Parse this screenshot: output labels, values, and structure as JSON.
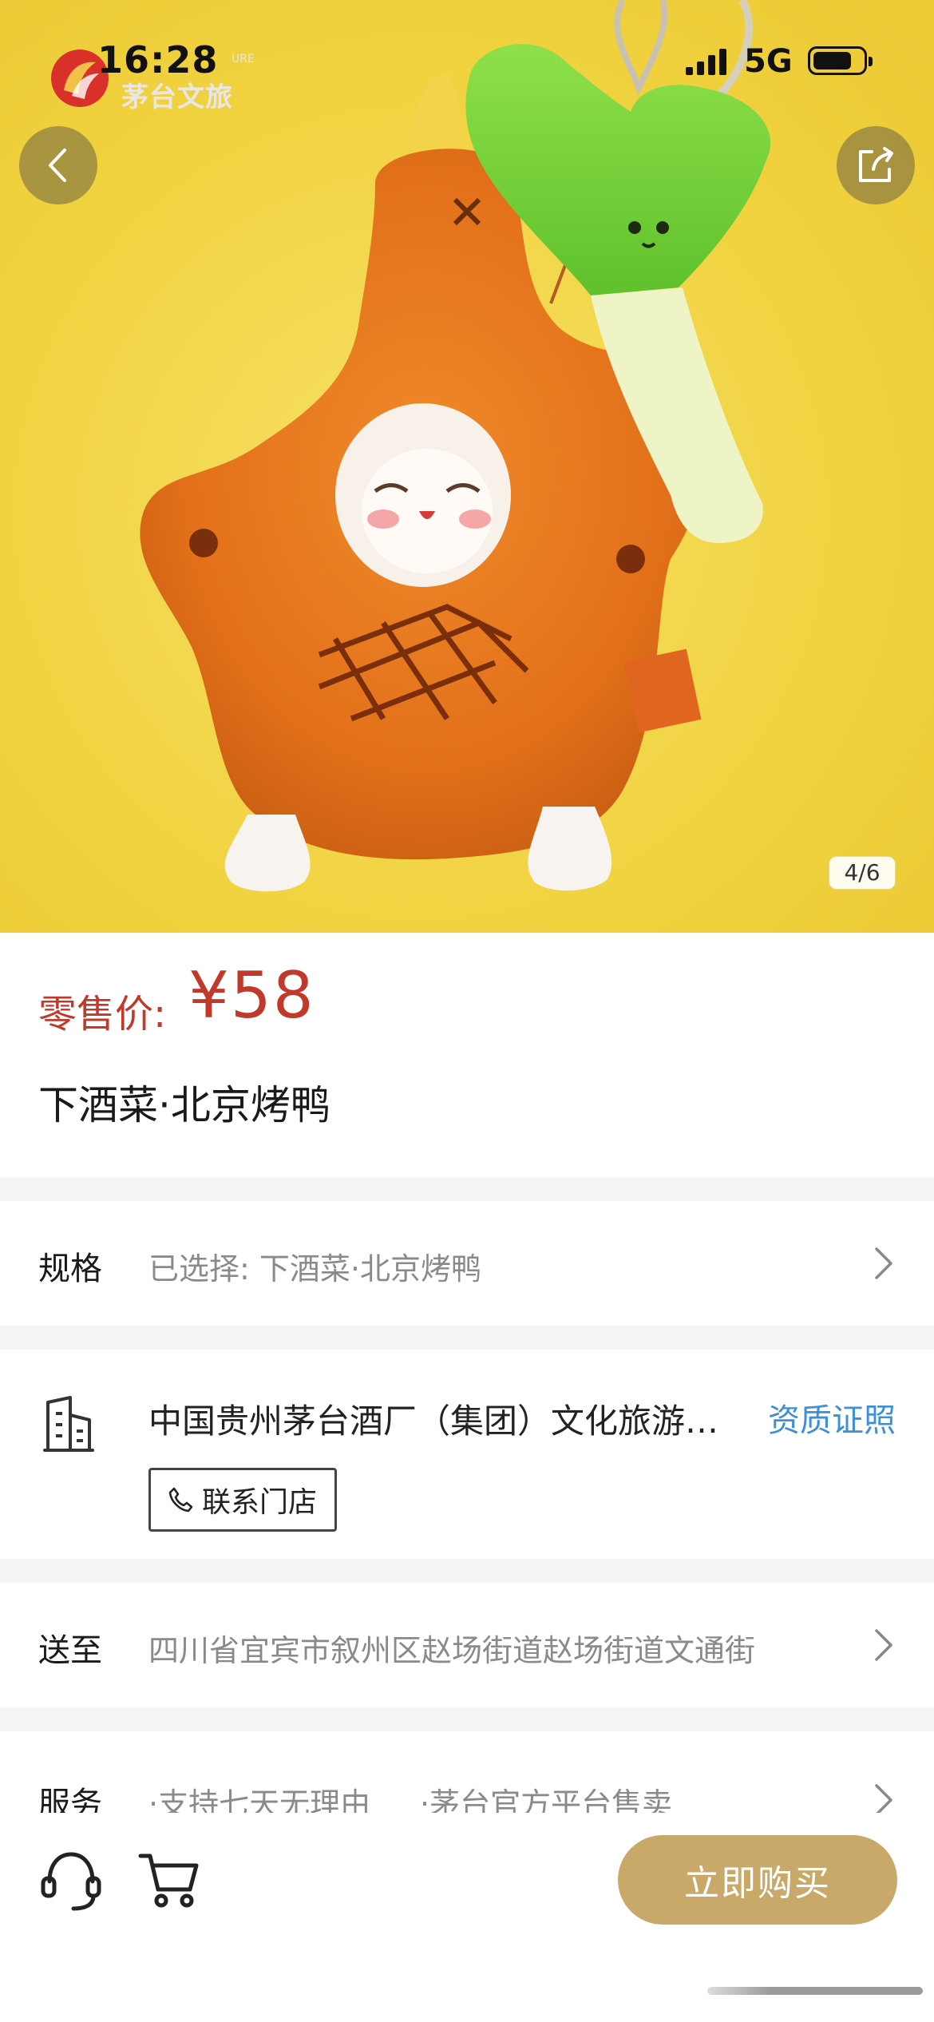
{
  "status_bar": {
    "time": "16:28",
    "network": "5G",
    "battery_level": 0.78
  },
  "brand": {
    "name": "茅台文旅",
    "sup": "URE"
  },
  "gallery": {
    "counter": "4/6",
    "background_color": "#f2d84a"
  },
  "product": {
    "price_label": "零售价:",
    "price": "¥58",
    "name": "下酒菜·北京烤鸭"
  },
  "spec": {
    "label": "规格",
    "value": "已选择: 下酒菜·北京烤鸭"
  },
  "shop": {
    "name": "中国贵州茅台酒厂（集团）文化旅游股份有限公司",
    "cert_link": "资质证照",
    "contact_button": "联系门店"
  },
  "shipping": {
    "label": "送至",
    "address": "四川省宜宾市叙州区赵场街道赵场街道文通街"
  },
  "service": {
    "label": "服务",
    "items": [
      "·支持七天无理由",
      "·茅台官方平台售卖"
    ]
  },
  "bottom_bar": {
    "buy_button": "立即购买"
  },
  "colors": {
    "price": "#c0392b",
    "link": "#3d8fd6",
    "buy_button": "#c9a96a"
  }
}
